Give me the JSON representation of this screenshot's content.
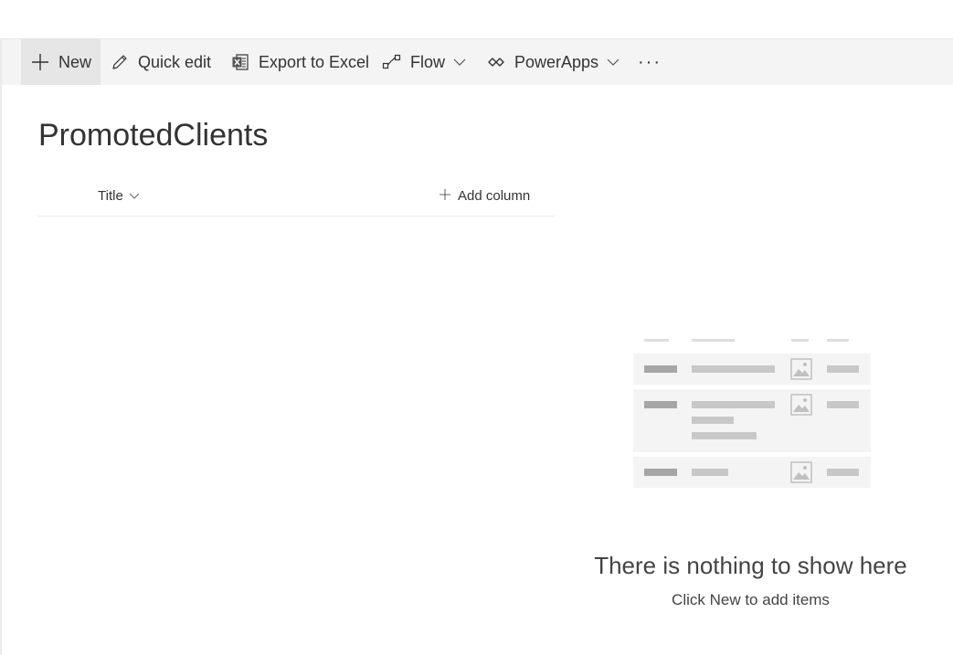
{
  "command_bar": {
    "new_label": "New",
    "quick_edit_label": "Quick edit",
    "export_label": "Export to Excel",
    "flow_label": "Flow",
    "powerapps_label": "PowerApps",
    "more_label": "···"
  },
  "list": {
    "title": "PromotedClients",
    "columns": [
      {
        "label": "Title"
      }
    ],
    "add_column_label": "Add column"
  },
  "empty_state": {
    "heading": "There is nothing to show here",
    "subtext": "Click New to add items"
  },
  "colors": {
    "command_bar_bg": "#f4f4f4",
    "new_button_bg": "#e6e6e6",
    "text": "#333333",
    "placeholder_bar": "#c8c8c8",
    "placeholder_row_bg": "#f4f4f4"
  }
}
